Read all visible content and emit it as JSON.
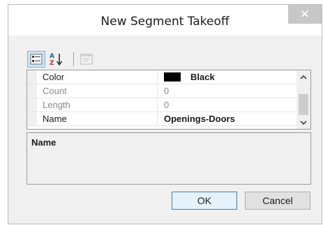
{
  "window": {
    "title": "New Segment Takeoff",
    "close_glyph": "✕"
  },
  "toolbar": {
    "buttons": [
      {
        "icon": "categorized-icon",
        "active": true
      },
      {
        "icon": "sort-alphabetical-icon",
        "active": false
      },
      {
        "icon": "property-pages-icon",
        "active": false,
        "disabled": true
      }
    ]
  },
  "property_grid": {
    "rows": [
      {
        "name": "Color",
        "value": "Black",
        "swatch": "#000000",
        "enabled": true
      },
      {
        "name": "Count",
        "value": "0",
        "enabled": false
      },
      {
        "name": "Length",
        "value": "0",
        "enabled": false
      },
      {
        "name": "Name",
        "value": "Openings-Doors",
        "enabled": true
      }
    ]
  },
  "description": {
    "title": "Name"
  },
  "buttons": {
    "ok": "OK",
    "cancel": "Cancel"
  },
  "colors": {
    "dialog_bg": "#f0f0f0",
    "close_bg": "#c7c7c7",
    "active_toolbar": "#cde4f7"
  }
}
